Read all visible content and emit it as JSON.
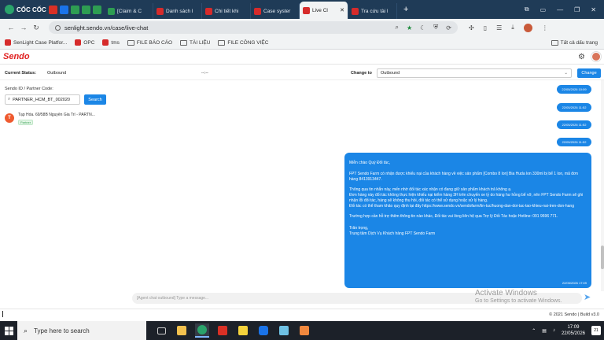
{
  "browser": {
    "brand": "CỐC CỐC",
    "tabs": [
      {
        "label": "[Claim & C",
        "active": false,
        "color": "#2e9d52"
      },
      {
        "label": "Danh sách l",
        "active": false,
        "color": "#d62b2b"
      },
      {
        "label": "Chi tiết khi",
        "active": false,
        "color": "#d62b2b"
      },
      {
        "label": "Case syster",
        "active": false,
        "color": "#d62b2b"
      },
      {
        "label": "Live Cl",
        "active": true,
        "color": "#d62b2b"
      },
      {
        "label": "Tra cứu tài l",
        "active": false,
        "color": "#d62b2b"
      }
    ],
    "url": "senlight.sendo.vn/case/live-chat",
    "bookmarks": [
      "SenLight Case Platfor...",
      "OPC",
      "tms",
      "FILE BÁO CÁO",
      "TÀI LIỆU",
      "FILE CÔNG VIỆC"
    ],
    "bookmarks_right": "Tất cả dấu trang"
  },
  "app": {
    "logo": "Sendo",
    "status_label": "Current Status:",
    "status_value": "Outbound",
    "timer": "--:--",
    "change_to_label": "Change to",
    "change_to_value": "Outbound",
    "change_button": "Change",
    "search_label": "Sendo ID / Partner Code:",
    "search_value": "PARTNER_HCM_BT_002020",
    "search_button": "Search",
    "contact": {
      "initial": "T",
      "name": "Tạp Hóa. 69/58B Nguyễn Gia Trí - PARTN...",
      "tag": "Partner"
    },
    "timestamps": [
      "22/05/2026 10:09",
      "22/05/2026 11:52",
      "22/05/2026 11:52",
      "22/05/2026 11:52"
    ],
    "message": {
      "lines": [
        "Miễn chào Quý Đối tác,",
        "FPT Sendo Farm có nhận được khiếu nại của khách hàng về việc sản phẩm [Combo 8 lon] Bia Huda lon 330ml bị bể 1 lon, mã đơn hàng 8413913447.",
        "Thông qua tin nhắn này, mến nhờ đối tác xác nhận có đang giữ sản phẩm  khách trả không ạ.",
        "Đơn hàng này đối tác không thực hiện khiếu nại kiểm hàng 3H trên chuyến xe tỷ do hàng hư hỏng bể vỡ, nên FPT Sendo Farm sẽ ghi nhận lỗi đối tác, hàng sẽ không thu hồi, đối tác có thể sử dụng hoặc xử lý hàng.",
        "Đối tác có thể tham khảo  quy định tại đây https://www.sendo.vn/sendofarm/tin-tuc/huong-dan-doi-tac-tao-khieu-nai-tren-don-hang",
        "Trường hợp cần hỗ trợ thêm thông tin nào khác, Đối tác vui lòng liên hệ qua Trợ lý Đối Tác hoặc Hotline: 091 9696 771.",
        "Trân trọng,",
        "Trung tâm Dịch Vụ Khách hàng FPT Sendo Farm"
      ],
      "time": "22/05/2026 17:09"
    },
    "composer_placeholder": "[Agent chat outbound] Type a message...",
    "footer": "© 2021 Sendo | Build v3.0"
  },
  "windows": {
    "watermark_title": "Activate Windows",
    "watermark_sub": "Go to Settings to activate Windows.",
    "taskbar_search": "Type here to search",
    "clock_time": "17:09",
    "clock_date": "22/05/2026",
    "notifications": "21"
  }
}
